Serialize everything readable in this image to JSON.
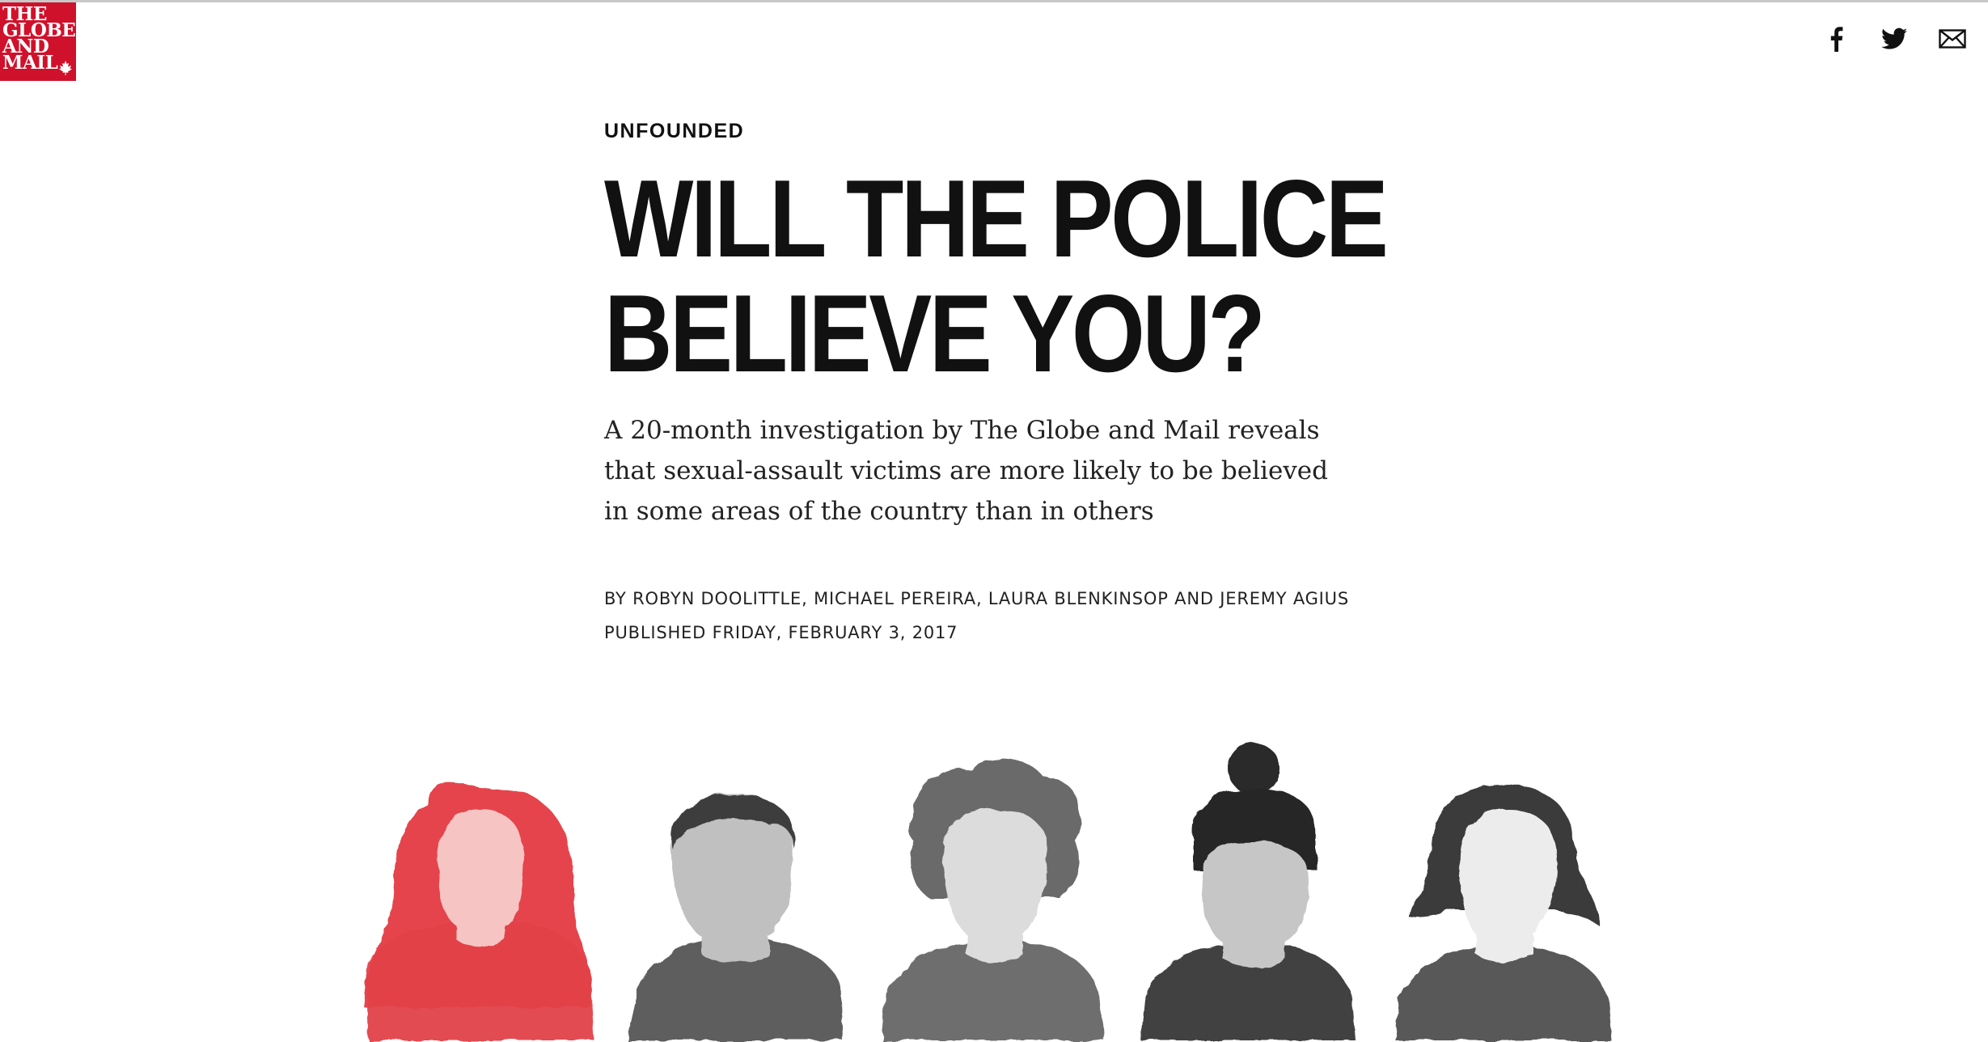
{
  "logo": {
    "lines": [
      "THE",
      "GLOBE",
      "AND",
      "MAIL"
    ],
    "brand_color": "#d0112b"
  },
  "share": {
    "icons": [
      "facebook-icon",
      "twitter-icon",
      "email-icon"
    ]
  },
  "article": {
    "kicker": "UNFOUNDED",
    "headline_lines": [
      "WILL THE POLICE",
      "BELIEVE YOU?"
    ],
    "dek": "A 20-month investigation by The Globe and Mail reveals that sexual-assault victims are more likely to be believed in some areas of the country than in others",
    "byline": "BY ROBYN DOOLITTLE, MICHAEL PEREIRA, LAURA BLENKINSOP AND JEREMY AGIUS",
    "published": "PUBLISHED FRIDAY, FEBRUARY 3, 2017"
  },
  "illustration": {
    "figures": [
      {
        "name": "figure-red",
        "color": "#e0393f"
      },
      {
        "name": "figure-gray-short-hair",
        "color": "#505050"
      },
      {
        "name": "figure-gray-curly-hair",
        "color": "#6a6a6a"
      },
      {
        "name": "figure-gray-bun",
        "color": "#2e2e2e"
      },
      {
        "name": "figure-gray-bob",
        "color": "#4a4a4a"
      }
    ]
  }
}
